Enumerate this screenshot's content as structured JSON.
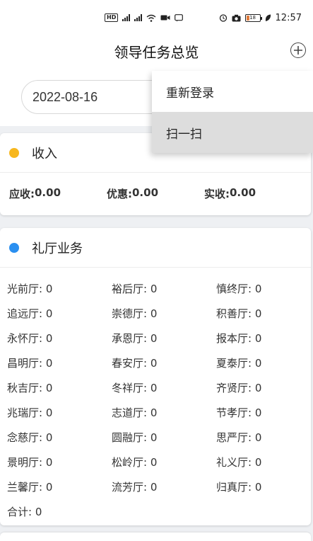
{
  "status_bar": {
    "time": "12:57",
    "battery": "18",
    "hd_label": "HD",
    "network": "4G"
  },
  "header": {
    "title": "领导任务总览"
  },
  "date": {
    "value": "2022-08-16"
  },
  "menu": {
    "items": [
      {
        "label": "重新登录"
      },
      {
        "label": "扫一扫"
      }
    ]
  },
  "income": {
    "title": "收入",
    "dot_color": "#f7b71e",
    "receivable_label": "应收:",
    "receivable_value": "0.00",
    "discount_label": "优惠:",
    "discount_value": "0.00",
    "received_label": "实收:",
    "received_value": "0.00"
  },
  "hall": {
    "title": "礼厅业务",
    "dot_color": "#2a8ff0",
    "cells": [
      "光前厅: 0",
      "裕后厅: 0",
      "慎终厅: 0",
      "追远厅: 0",
      "崇德厅: 0",
      "积善厅: 0",
      "永怀厅: 0",
      "承恩厅: 0",
      "报本厅: 0",
      "昌明厅: 0",
      "春安厅: 0",
      "夏泰厅: 0",
      "秋吉厅: 0",
      "冬祥厅: 0",
      "齐贤厅: 0",
      "兆瑞厅: 0",
      "志道厅: 0",
      "节孝厅: 0",
      "念慈厅: 0",
      "圆融厅: 0",
      "思严厅: 0",
      "景明厅: 0",
      "松岭厅: 0",
      "礼义厅: 0",
      "兰馨厅: 0",
      "流芳厅: 0",
      "归真厅: 0"
    ],
    "total": "合计: 0"
  }
}
